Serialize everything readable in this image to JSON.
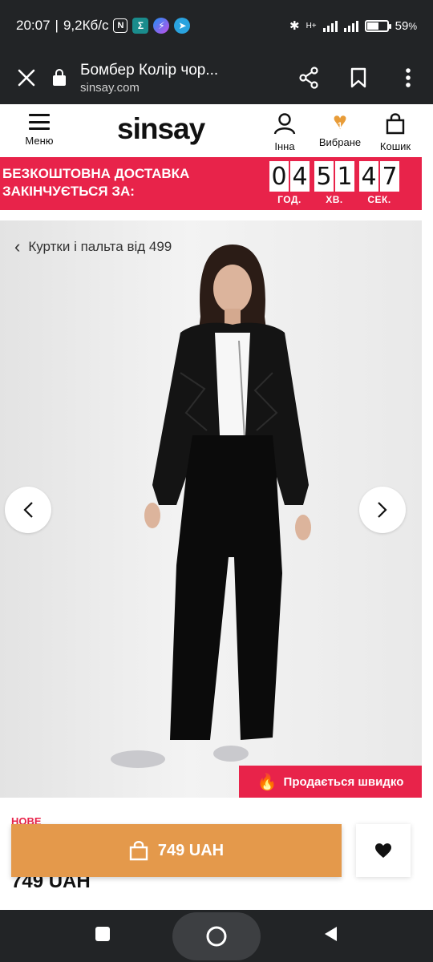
{
  "status_bar": {
    "time": "20:07",
    "net_speed": "9,2Кб/с",
    "network_type": "H+",
    "battery": "59",
    "battery_unit": "%"
  },
  "browser": {
    "page_title": "Бомбер Колір чор...",
    "domain": "sinsay.com"
  },
  "header": {
    "logo": "sinsay",
    "menu_label": "Меню",
    "account_label": "Інна",
    "wishlist_label": "Вибране",
    "wishlist_count": "1",
    "cart_label": "Кошик"
  },
  "promo": {
    "line1": "БЕЗКОШТОВНА ДОСТАВКА",
    "line2": "ЗАКІНЧУЄТЬСЯ ЗА:",
    "hours": [
      "0",
      "4"
    ],
    "minutes": [
      "5",
      "1"
    ],
    "seconds": [
      "4",
      "7"
    ],
    "hours_label": "ГОД.",
    "minutes_label": "ХВ.",
    "seconds_label": "СЕК."
  },
  "product": {
    "breadcrumb": "Куртки і пальта від 499",
    "badge": "Продається швидко",
    "new_label": "НОВЕ",
    "price": "749 UAH",
    "buy_label": "749 UAH"
  },
  "colors": {
    "accent_red": "#e8234a",
    "buy_orange": "#e4994b",
    "dark_bar": "#222426"
  },
  "icons": [
    "close-icon",
    "lock-icon",
    "share-icon",
    "bookmark-icon",
    "more-icon",
    "menu-icon",
    "user-icon",
    "heart-icon",
    "bag-icon",
    "chevron-left-icon",
    "chevron-right-icon",
    "fire-icon"
  ]
}
